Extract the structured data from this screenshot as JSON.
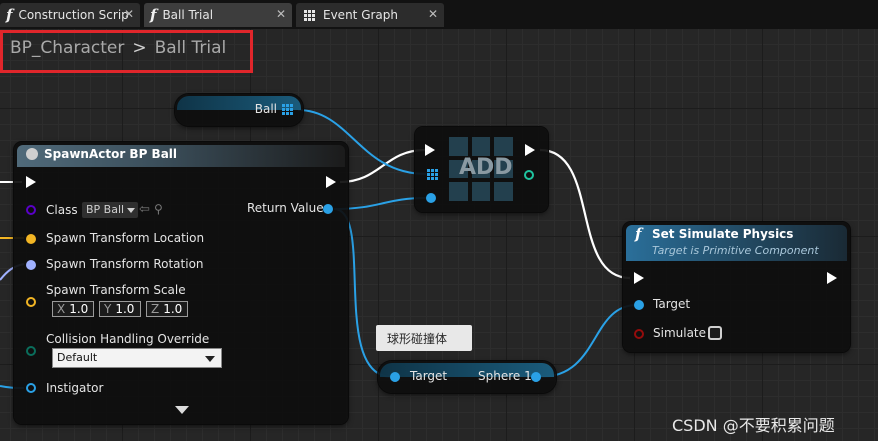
{
  "tabs": [
    {
      "label": "Construction Scrip",
      "icon": "function-icon"
    },
    {
      "label": "Ball Trial",
      "icon": "function-icon"
    },
    {
      "label": "Event Graph",
      "icon": "event-graph-icon"
    }
  ],
  "tab_close_glyph": "✕",
  "function_glyph": "f",
  "breadcrumb": {
    "parent": "BP_Character",
    "separator": ">",
    "current": "Ball Trial"
  },
  "ball_node": {
    "label": "Ball"
  },
  "spawn_node": {
    "title": "SpawnActor BP Ball",
    "class_label": "Class",
    "class_value": "BP Ball",
    "return_label": "Return Value",
    "spawn_location": "Spawn Transform Location",
    "spawn_rotation": "Spawn Transform Rotation",
    "spawn_scale": "Spawn Transform Scale",
    "scale": {
      "x_label": "X",
      "x": "1.0",
      "y_label": "Y",
      "y": "1.0",
      "z_label": "Z",
      "z": "1.0"
    },
    "collision_label": "Collision Handling Override",
    "collision_value": "Default",
    "instigator_label": "Instigator"
  },
  "add_node": {
    "label": "ADD"
  },
  "physics_node": {
    "title": "Set Simulate Physics",
    "subtitle": "Target is Primitive Component",
    "target_label": "Target",
    "simulate_label": "Simulate"
  },
  "component_node": {
    "tooltip": "球形碰撞体",
    "target_label": "Target",
    "output_label": "Sphere 1"
  },
  "watermark": "CSDN @不要积累问题",
  "colors": {
    "exec": "#ffffff",
    "object": "#2aa1e6",
    "struct": "#f2b524",
    "rotator": "#a0b1ff",
    "bool": "#950c0c",
    "class": "#5a00c8",
    "enum": "#0a6e5c",
    "red_box": "#e0262b"
  }
}
